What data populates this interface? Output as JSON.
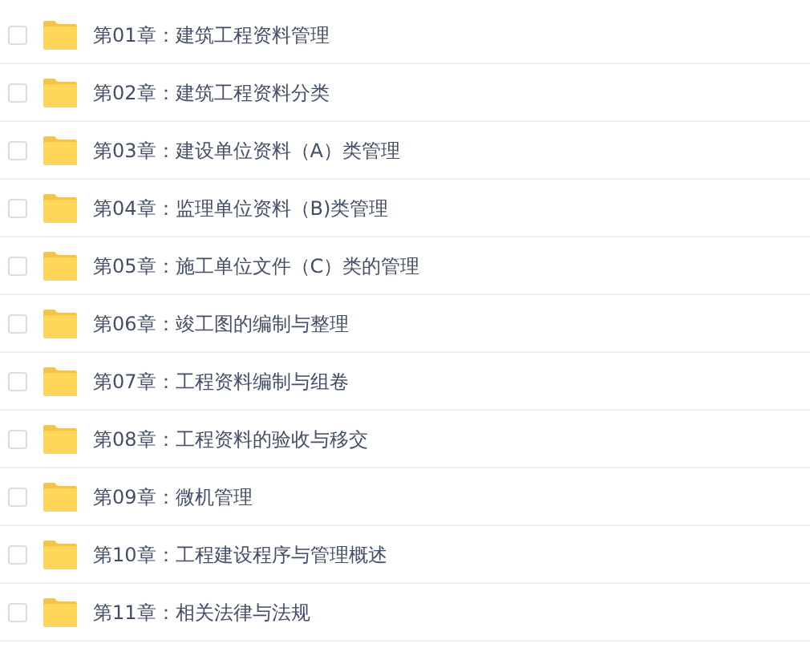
{
  "files": [
    {
      "name": "第01章：建筑工程资料管理",
      "checked": false
    },
    {
      "name": "第02章：建筑工程资料分类",
      "checked": false
    },
    {
      "name": "第03章：建设单位资料（A）类管理",
      "checked": false
    },
    {
      "name": "第04章：监理单位资料（B)类管理",
      "checked": false
    },
    {
      "name": "第05章：施工单位文件（C）类的管理",
      "checked": false
    },
    {
      "name": "第06章：竣工图的编制与整理",
      "checked": false
    },
    {
      "name": "第07章：工程资料编制与组卷",
      "checked": false
    },
    {
      "name": "第08章：工程资料的验收与移交",
      "checked": false
    },
    {
      "name": "第09章：微机管理",
      "checked": false
    },
    {
      "name": "第10章：工程建设程序与管理概述",
      "checked": false
    },
    {
      "name": "第11章：相关法律与法规",
      "checked": false
    }
  ]
}
